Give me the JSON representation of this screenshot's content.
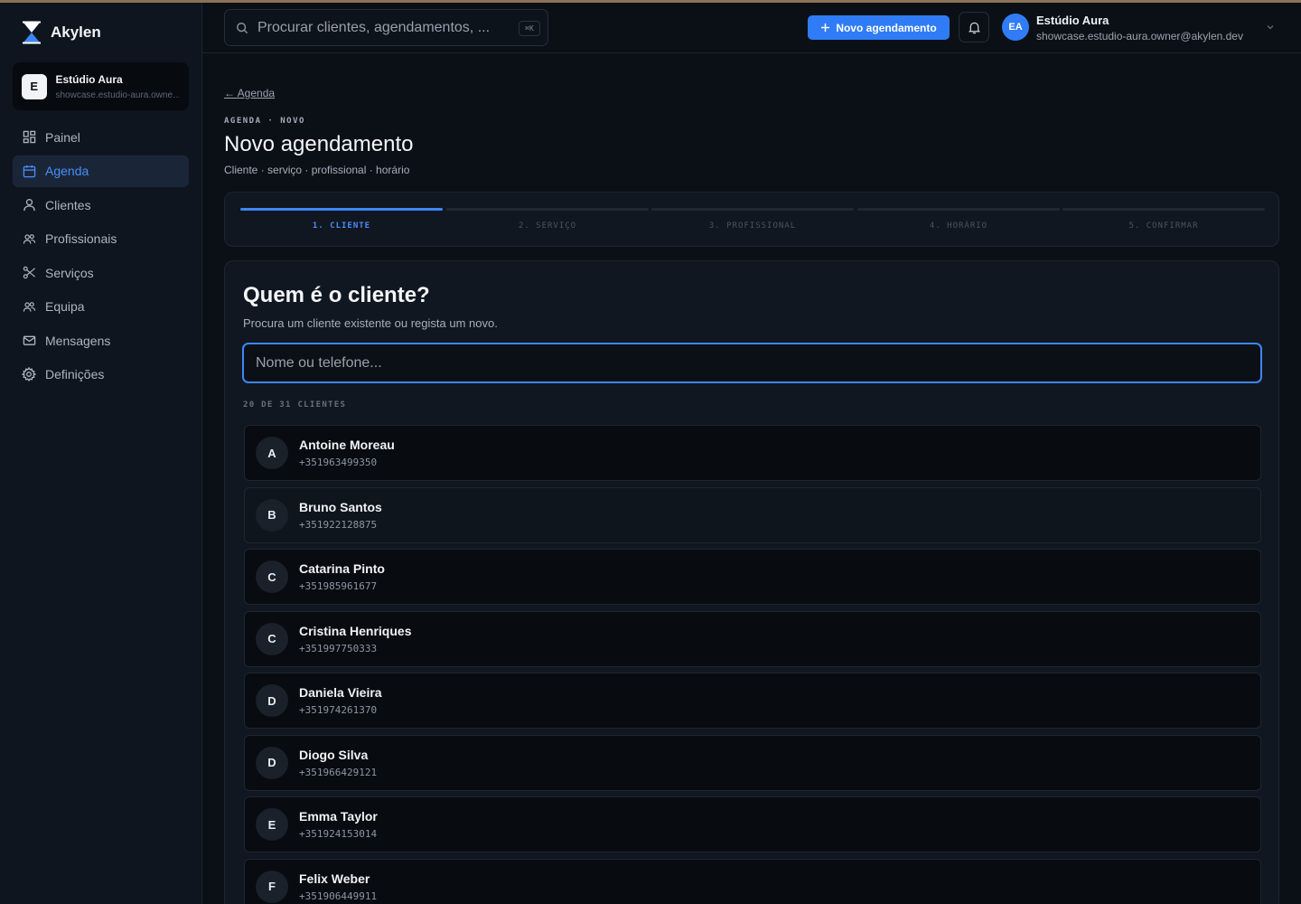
{
  "colors": {
    "accent": "#2f7cf6",
    "background": "#0b1017",
    "sidebar": "#0f151e"
  },
  "brand": {
    "name": "Akylen",
    "icon": "hourglass-logo-icon"
  },
  "org": {
    "initial": "E",
    "name": "Estúdio Aura",
    "email": "showcase.estudio-aura.owner@akylen.dev"
  },
  "sidebar": {
    "items": [
      {
        "label": "Painel",
        "icon": "dashboard-icon",
        "active": false
      },
      {
        "label": "Agenda",
        "icon": "calendar-icon",
        "active": true
      },
      {
        "label": "Clientes",
        "icon": "user-icon",
        "active": false
      },
      {
        "label": "Profissionais",
        "icon": "users-icon",
        "active": false
      },
      {
        "label": "Serviços",
        "icon": "scissors-icon",
        "active": false
      },
      {
        "label": "Equipa",
        "icon": "team-icon",
        "active": false
      },
      {
        "label": "Mensagens",
        "icon": "mail-icon",
        "active": false
      },
      {
        "label": "Definições",
        "icon": "gear-icon",
        "active": false
      }
    ]
  },
  "header": {
    "search_placeholder": "Procurar clientes, agendamentos, ...",
    "search_shortcut": "⌘K",
    "new_button": "Novo agendamento",
    "user": {
      "initials": "EA",
      "name": "Estúdio Aura",
      "email": "showcase.estudio-aura.owner@akylen.dev"
    }
  },
  "page": {
    "back_link": "← Agenda",
    "eyebrow": "AGENDA · NOVO",
    "title": "Novo agendamento",
    "subtitle": "Cliente · serviço · profissional · horário"
  },
  "steps": [
    {
      "label": "1. CLIENTE",
      "active": true
    },
    {
      "label": "2. SERVIÇO",
      "active": false
    },
    {
      "label": "3. PROFISSIONAL",
      "active": false
    },
    {
      "label": "4. HORÁRIO",
      "active": false
    },
    {
      "label": "5. CONFIRMAR",
      "active": false
    }
  ],
  "client_step": {
    "title": "Quem é o cliente?",
    "subtitle": "Procura um cliente existente ou regista um novo.",
    "input_placeholder": "Nome ou telefone...",
    "count_label": "20 DE 31 CLIENTES",
    "clients": [
      {
        "initial": "A",
        "name": "Antoine Moreau",
        "phone": "+351963499350"
      },
      {
        "initial": "B",
        "name": "Bruno Santos",
        "phone": "+351922128875"
      },
      {
        "initial": "C",
        "name": "Catarina Pinto",
        "phone": "+351985961677"
      },
      {
        "initial": "C",
        "name": "Cristina Henriques",
        "phone": "+351997750333"
      },
      {
        "initial": "D",
        "name": "Daniela Vieira",
        "phone": "+351974261370"
      },
      {
        "initial": "D",
        "name": "Diogo Silva",
        "phone": "+351966429121"
      },
      {
        "initial": "E",
        "name": "Emma Taylor",
        "phone": "+351924153014"
      },
      {
        "initial": "F",
        "name": "Felix Weber",
        "phone": "+351906449911"
      }
    ]
  }
}
